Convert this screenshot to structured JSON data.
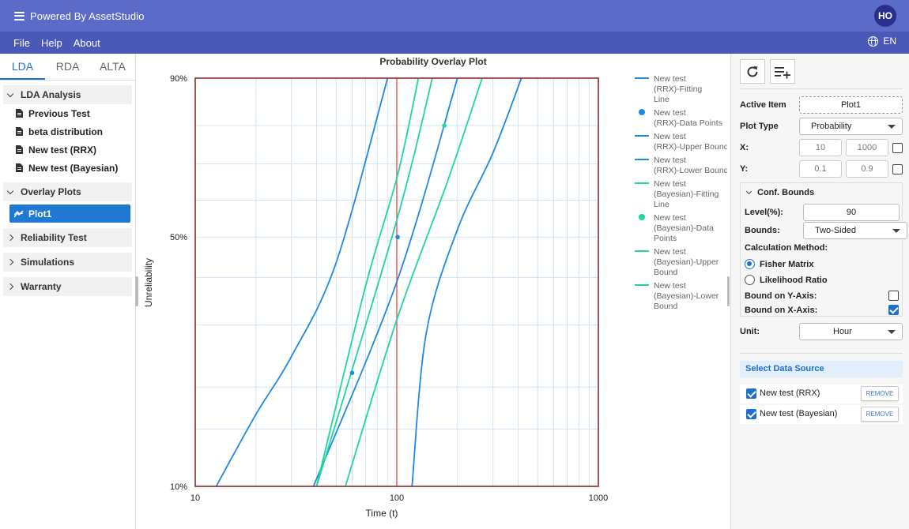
{
  "app": {
    "title": "Powered By AssetStudio",
    "user_initials": "HO"
  },
  "menu": {
    "items": [
      "File",
      "Help",
      "About"
    ],
    "language": "EN"
  },
  "sidebar": {
    "tabs": [
      "LDA",
      "RDA",
      "ALTA"
    ],
    "groups": {
      "lda_analysis": {
        "label": "LDA Analysis",
        "items": [
          "Previous Test",
          "beta distribution",
          "New test (RRX)",
          "New test (Bayesian)"
        ]
      },
      "overlay_plots": {
        "label": "Overlay Plots",
        "items": [
          "Plot1"
        ]
      },
      "reliability_test": {
        "label": "Reliability Test"
      },
      "simulations": {
        "label": "Simulations"
      },
      "warranty": {
        "label": "Warranty"
      }
    }
  },
  "chart_data": {
    "type": "line",
    "title": "Probability Overlay Plot",
    "xlabel": "Time (t)",
    "ylabel": "Unreliability",
    "x_scale": "log",
    "y_scale": "weibull-probability",
    "xlim": [
      10,
      1000
    ],
    "ylim": [
      10,
      90
    ],
    "x_ticks": [
      "10",
      "100",
      "1000"
    ],
    "y_ticks": [
      "90%",
      "50%",
      "10%"
    ],
    "grid": true,
    "legend_position": "right",
    "reference_line_x": 100,
    "series": [
      {
        "name": "New test (RRX)-Fitting Line",
        "color": "#1e88e5",
        "kind": "line",
        "points": [
          [
            38.6,
            10
          ],
          [
            100,
            39
          ],
          [
            200,
            90
          ]
        ]
      },
      {
        "name": "New test (RRX)-Data Points",
        "color": "#1e88e5",
        "kind": "points",
        "points": [
          [
            60,
            22
          ],
          [
            101,
            50
          ]
        ]
      },
      {
        "name": "New test (RRX)-Upper Bound",
        "color": "#1e88e5",
        "kind": "line",
        "points": [
          [
            12.7,
            10
          ],
          [
            20,
            16.6
          ],
          [
            30,
            24.5
          ],
          [
            50,
            43.5
          ],
          [
            90,
            90
          ]
        ]
      },
      {
        "name": "New test (RRX)-Lower Bound",
        "color": "#1e88e5",
        "kind": "line",
        "points": [
          [
            119,
            10
          ],
          [
            140,
            28.5
          ],
          [
            200,
            52
          ],
          [
            300,
            73
          ],
          [
            415,
            90
          ]
        ]
      },
      {
        "name": "New test (Bayesian)-Fitting Line",
        "color": "#1dd6a0",
        "kind": "line",
        "points": [
          [
            40,
            10
          ],
          [
            100,
            54.5
          ],
          [
            150,
            90
          ]
        ]
      },
      {
        "name": "New test (Bayesian)-Data Points",
        "color": "#1dd6a0",
        "kind": "points",
        "points": [
          [
            172,
            80
          ]
        ]
      },
      {
        "name": "New test (Bayesian)-Upper Bound",
        "color": "#1dd6a0",
        "kind": "line",
        "points": [
          [
            40,
            10
          ],
          [
            70,
            38
          ],
          [
            101,
            67
          ],
          [
            128,
            90
          ]
        ]
      },
      {
        "name": "New test (Bayesian)-Lower Bound",
        "color": "#1dd6a0",
        "kind": "line",
        "points": [
          [
            55.6,
            10
          ],
          [
            100,
            31
          ],
          [
            178,
            65
          ],
          [
            265,
            90
          ]
        ]
      }
    ]
  },
  "props": {
    "active_item": {
      "label": "Active Item",
      "value": "Plot1"
    },
    "plot_type": {
      "label": "Plot Type",
      "value": "Probability"
    },
    "x": {
      "label": "X:",
      "min": "10",
      "max": "1000"
    },
    "y": {
      "label": "Y:",
      "min": "0.1",
      "max": "0.9"
    },
    "conf_bounds": {
      "title": "Conf. Bounds",
      "level_label": "Level(%):",
      "level_value": "90",
      "bounds_label": "Bounds:",
      "bounds_value": "Two-Sided",
      "calc_label": "Calculation Method:",
      "fisher": "Fisher Matrix",
      "likelihood": "Likelihood Ratio",
      "y_axis_label": "Bound on Y-Axis:",
      "x_axis_label": "Bound on X-Axis:"
    },
    "unit": {
      "label": "Unit:",
      "value": "Hour"
    }
  },
  "data_source": {
    "header": "Select Data Source",
    "rows": [
      {
        "name": "New test (RRX)",
        "remove": "REMOVE"
      },
      {
        "name": "New test (Bayesian)",
        "remove": "REMOVE"
      }
    ]
  }
}
